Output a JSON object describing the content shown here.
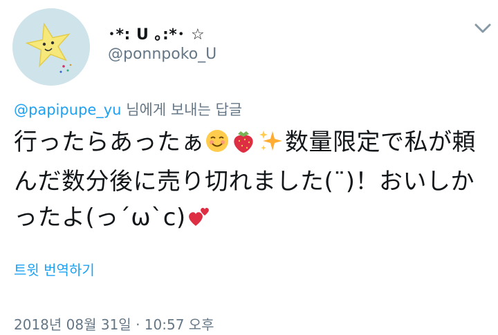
{
  "author": {
    "display_name": "･*: U ｡:*･ ☆",
    "handle": "@ponnpoko_U"
  },
  "reply": {
    "user": "@papipupe_yu",
    "suffix": "님에게 보내는 답글"
  },
  "tweet": {
    "segments": [
      "行ったらあったぁ",
      "数量限定で私が頼んだ数分後に売り切れました(¨)！おいしかったよ(っ´ω`c)"
    ],
    "emojis": [
      "smiling-face-icon",
      "strawberry-icon",
      "sparkles-icon",
      "two-hearts-icon"
    ]
  },
  "actions": {
    "translate": "트윗 번역하기"
  },
  "meta": {
    "timestamp": "2018년 08월 31일 · 10:57 오후"
  },
  "colors": {
    "accent": "#1da1f2",
    "secondary_text": "#657786",
    "primary_text": "#14171a",
    "avatar_bg": "#cfe3ea"
  }
}
